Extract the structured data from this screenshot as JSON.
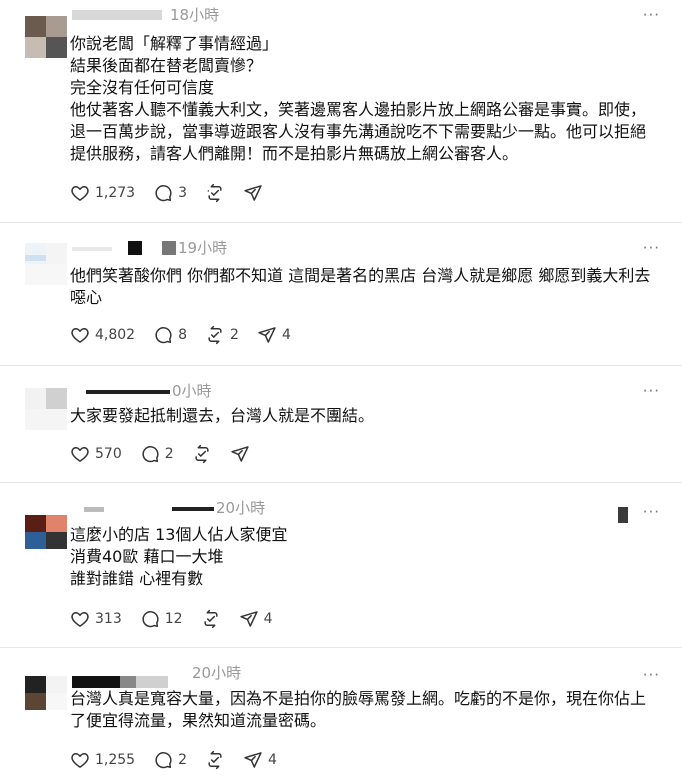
{
  "posts": [
    {
      "time": "18小時",
      "lines": [
        "你說老闆「解釋了事情經過」",
        "結果後面都在替老闆賣慘？",
        "完全沒有任何可信度",
        "他仗著客人聽不懂義大利文，笑著邊罵客人邊拍影片放上網路公審是事實。即使，",
        "退一百萬步說，當事導遊跟客人沒有事先溝通說吃不下需要點少一點。他可以拒絕",
        "提供服務，請客人們離開！而不是拍影片無碼放上網公審客人。"
      ],
      "likes": "1,273",
      "comments": "3",
      "reposts": "",
      "shares": ""
    },
    {
      "time": "19小時",
      "lines": [
        "他們笑著酸你們 你們都不知道 這間是著名的黑店 台灣人就是鄉愿 鄉愿到義大利去",
        "噁心"
      ],
      "likes": "4,802",
      "comments": "8",
      "reposts": "2",
      "shares": "4"
    },
    {
      "time": "0小時",
      "lines": [
        "大家要發起抵制還去，台灣人就是不團結。"
      ],
      "likes": "570",
      "comments": "2",
      "reposts": "",
      "shares": ""
    },
    {
      "time": "20小時",
      "lines": [
        "這麼小的店 13個人佔人家便宜",
        "消費40歐 藉口一大堆",
        "誰對誰錯 心裡有數"
      ],
      "likes": "313",
      "comments": "12",
      "reposts": "",
      "shares": "4"
    },
    {
      "time": "20小時",
      "lines": [
        "台灣人真是寬容大量，因為不是拍你的臉辱罵發上網。吃虧的不是你，現在你佔上",
        "了便宜得流量，果然知道流量密碼。"
      ],
      "likes": "1,255",
      "comments": "2",
      "reposts": "",
      "shares": "4"
    }
  ],
  "icons": {
    "like": "heart-icon",
    "comment": "comment-icon",
    "repost": "repost-icon",
    "share": "send-icon",
    "more": "more-icon"
  },
  "more_glyph": "···",
  "colors": {
    "text": "#111111",
    "muted": "#999999",
    "divider": "#e6e6e6",
    "icon": "#333333"
  }
}
